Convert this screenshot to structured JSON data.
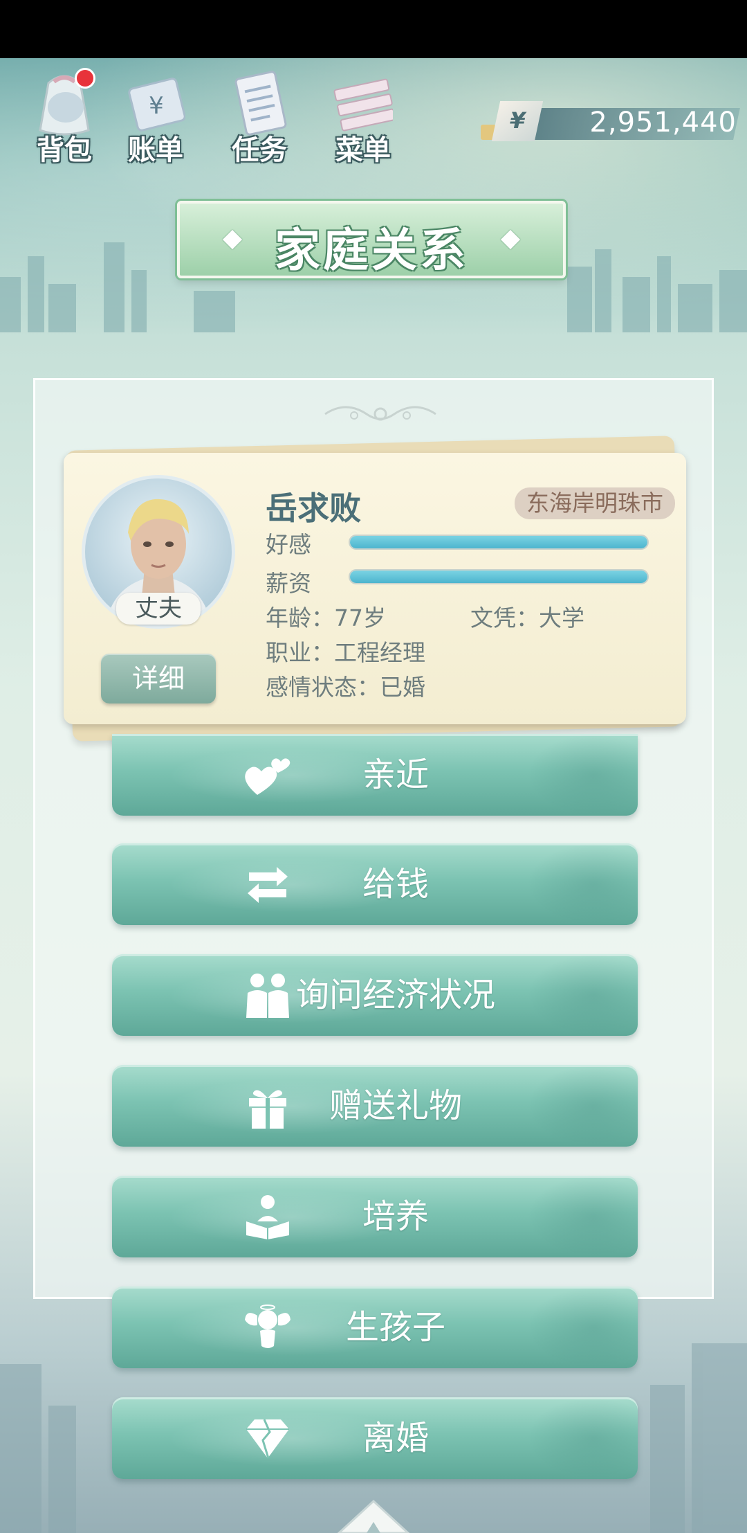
{
  "topbar": {
    "items": [
      {
        "label": "背包",
        "icon": "backpack-icon",
        "has_notification": true
      },
      {
        "label": "账单",
        "icon": "bill-icon"
      },
      {
        "label": "任务",
        "icon": "task-icon"
      },
      {
        "label": "菜单",
        "icon": "menu-icon"
      }
    ],
    "currency_symbol": "¥",
    "money": "2,951,440"
  },
  "title": "家庭关系",
  "person": {
    "name": "岳求败",
    "location": "东海岸明珠市",
    "role": "丈夫",
    "detail_label": "详细",
    "affection_label": "好感",
    "affection_level": 1.0,
    "salary_label": "薪资",
    "salary_level": 1.0,
    "age": "年龄：77岁",
    "education": "文凭：大学",
    "job": "职业：工程经理",
    "relationship": "感情状态：已婚"
  },
  "actions": [
    {
      "label": "亲近",
      "icon": "hearts-icon"
    },
    {
      "label": "给钱",
      "icon": "give-money-icon"
    },
    {
      "label": "询问经济状况",
      "icon": "people-icon"
    },
    {
      "label": "赠送礼物",
      "icon": "gift-icon"
    },
    {
      "label": "培养",
      "icon": "reading-child-icon"
    },
    {
      "label": "生孩子",
      "icon": "baby-angel-icon"
    },
    {
      "label": "离婚",
      "icon": "broken-diamond-icon"
    }
  ],
  "colors": {
    "accent": "#7cc3b2",
    "bar_fill": "#4db5ce",
    "name_color": "#4b6f78",
    "notification": "#e8333a"
  }
}
